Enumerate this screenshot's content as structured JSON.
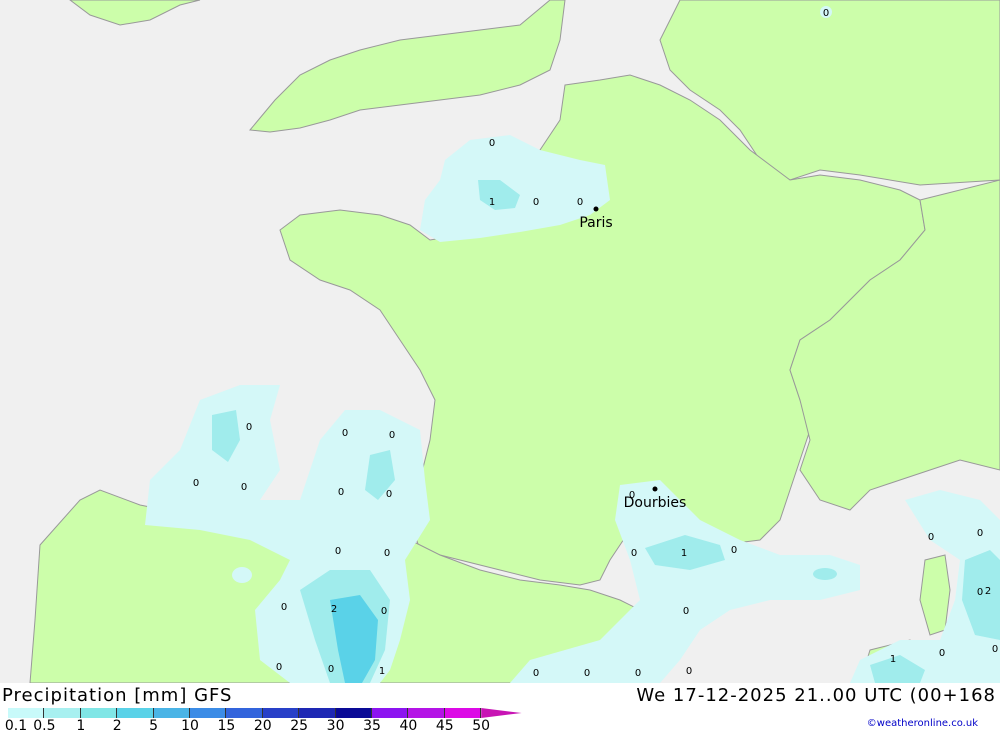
{
  "map": {
    "cities": [
      {
        "name": "Paris"
      },
      {
        "name": "Dourbies"
      }
    ],
    "point_values": [
      "0",
      "0",
      "1",
      "0",
      "0",
      "0",
      "0",
      "0",
      "0",
      "0",
      "0",
      "0",
      "0",
      "0",
      "0",
      "0",
      "0",
      "2",
      "0",
      "0",
      "0",
      "1",
      "0",
      "1",
      "0",
      "0",
      "0",
      "0",
      "0",
      "0",
      "0",
      "0",
      "0",
      "2",
      "1",
      "0"
    ]
  },
  "footer": {
    "title": "Precipitation [mm] GFS",
    "datetime": "We 17-12-2025 21..00 UTC (00+168",
    "credit": "©weatheronline.co.uk"
  },
  "legend": {
    "ticks": [
      "0.1",
      "0.5",
      "1",
      "2",
      "5",
      "10",
      "15",
      "20",
      "25",
      "30",
      "35",
      "40",
      "45",
      "50"
    ],
    "colors": [
      "#c8fafa",
      "#a8f0f0",
      "#80e6e6",
      "#5ad2e8",
      "#4ab4e6",
      "#3c8ce6",
      "#3264dc",
      "#2840c8",
      "#1e28b4",
      "#0a0a96",
      "#8c14f0",
      "#b414e6",
      "#dc0ae6",
      "#c814b4"
    ]
  },
  "colors": {
    "sea": "#f0f0f0",
    "land": "#ccfeaa",
    "border": "#999999",
    "precip_light": "#d4f8f8",
    "precip_mid": "#a0ecec",
    "precip_heavy": "#5ad2e8"
  }
}
